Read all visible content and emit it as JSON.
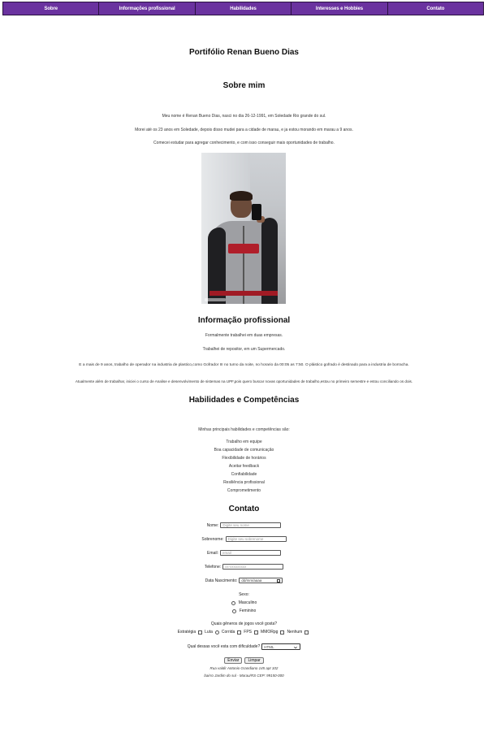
{
  "nav": [
    "Sobre",
    "Informações profissional",
    "Habilidades",
    "Interesses e Hobbies",
    "Contato"
  ],
  "title": "Portifólio Renan Bueno Dias",
  "about": {
    "heading": "Sobre mim",
    "paragraphs": [
      "Meu nome é Renan Bueno Dias, nasci no dia 26-12-1991, em Soledade Rio grande do sul.",
      "Morei até os 23 anos em Soledade, depois disso mudei para a cidade de marau, e ja estou morando em marau a 9 anos.",
      "Comecei estudar para agregar conhecimento, e com isso conseguir mais oportunidades de trabalho."
    ]
  },
  "professional": {
    "heading": "Informação profissional",
    "paragraphs": [
      "Formalmente trabalhei em duas empresas.",
      "Trabalhei de repositor, em um Supermercado.",
      "E a mais de 9 anos, trabalho de operador na industria de plastico,como Gofrador III no turno da noite, no horario da 00:05 as 7:50. O plástico gofrado é destinado para a industria de borracha.",
      "Atualmente além de trabalhar, iniciei o curso de Analise e desenvolvimento de sistemas na UPF,pois quero buscar novas oportunidades de trabalho,estou no primeiro semestre e estou conciliando os dois."
    ]
  },
  "skills": {
    "heading": "Habilidades e Competências",
    "intro": "Minhas principais habilidades e competências são:",
    "items": [
      "Trabalho em equipe",
      "Boa capacidade de comunicação",
      "Flexibilidade de horários",
      "Aceitar feedback",
      "Confiabilidade",
      "Resiliência profissional",
      "Comprometimento"
    ]
  },
  "contact": {
    "heading": "Contato",
    "name_label": "Nome:",
    "name_placeholder": "Digite seu nome",
    "surname_label": "Sobrenome:",
    "surname_placeholder": "Digite seu sobrenome",
    "email_label": "Email:",
    "email_placeholder": "email",
    "phone_label": "Telefone:",
    "phone_placeholder": "xx-xxxxxxxxx",
    "birth_label": "Data Nascimento:",
    "birth_placeholder": "dd/mm/aaaa",
    "sex_label": "Sexo:",
    "sex_options": [
      "Masculino",
      "Feminino"
    ],
    "games_question": "Quais gêneros de jogos você gosta?",
    "games_options": [
      "Estratégia",
      "Luta",
      "Corrida",
      "FPS",
      "MMORpg",
      "Nenhum"
    ],
    "difficulty_label": "Qual dessas você esta com dificuldade?",
    "difficulty_value": "HTML",
    "submit_label": "Enviar",
    "reset_label": "Limpar"
  },
  "footer": [
    "Rua valdir Antonio Grandiano 145 apt 102",
    "bairro Jardim do sul - Marau/RS CEP: 99150-000"
  ]
}
